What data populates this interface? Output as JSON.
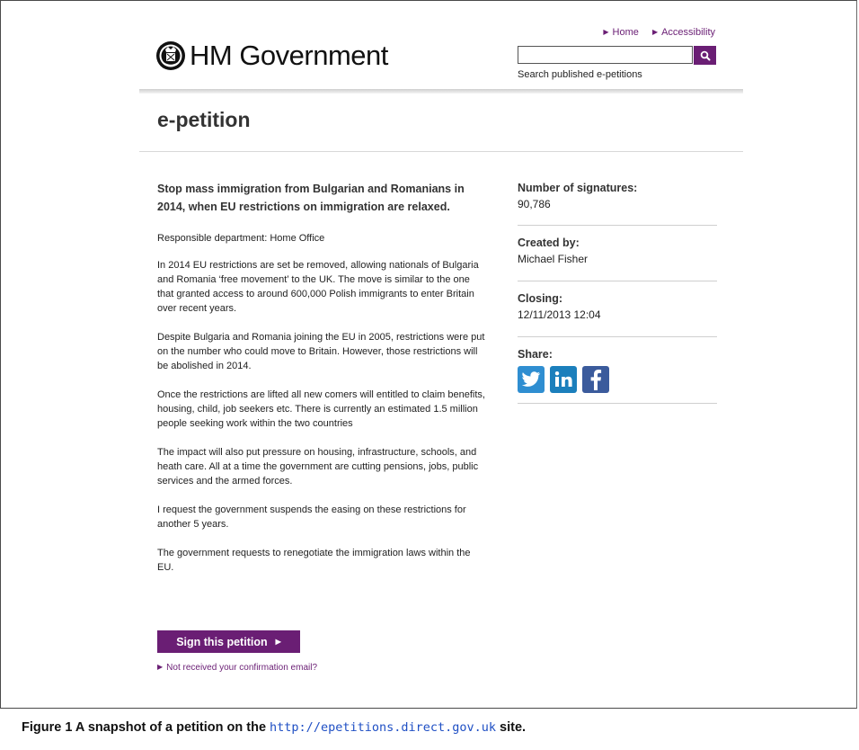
{
  "header": {
    "logo_text": "HM Government",
    "nav": [
      {
        "label": "Home"
      },
      {
        "label": "Accessibility"
      }
    ],
    "search": {
      "value": "",
      "caption": "Search published e-petitions"
    }
  },
  "page_title": "e-petition",
  "petition": {
    "heading": "Stop mass immigration from Bulgarian and Romanians in 2014, when EU restrictions on immigration are relaxed.",
    "department": "Responsible department: Home Office",
    "paragraphs": [
      "In 2014 EU restrictions are set be removed, allowing nationals of Bulgaria and Romania ‘free movement’ to the UK. The move is similar to the one that granted access to around 600,000 Polish immigrants to enter Britain over recent years.",
      "Despite Bulgaria and Romania joining the EU in 2005, restrictions were put on the number who could move to Britain. However, those restrictions will be abolished in 2014.",
      "Once the restrictions are lifted all new comers will entitled to claim benefits, housing, child, job seekers etc. There is currently an estimated 1.5 million people seeking work within the two countries",
      "The impact will also put pressure on housing, infrastructure, schools, and heath care. All at a time the government are cutting pensions, jobs, public services and the armed forces.",
      "I request the government suspends the easing on these restrictions for another 5 years.",
      "The government requests to renegotiate the immigration laws within the EU."
    ],
    "sign_button": "Sign this petition",
    "confirmation_link": "Not received your confirmation email?"
  },
  "sidebar": {
    "signatures_label": "Number of signatures:",
    "signatures_value": "90,786",
    "created_label": "Created by:",
    "created_value": "Michael Fisher",
    "closing_label": "Closing:",
    "closing_value": "12/11/2013 12:04",
    "share_label": "Share:",
    "share_icons": [
      "twitter-icon",
      "linkedin-icon",
      "facebook-icon"
    ]
  },
  "caption": {
    "prefix": "Figure 1  A snapshot of a petition on the",
    "url": "http://epetitions.direct.gov.uk",
    "suffix": "site."
  },
  "colors": {
    "accent": "#6a1e74",
    "twitter": "#2f8ed1",
    "linkedin": "#1b7fbc",
    "facebook": "#3b5b9c",
    "caption_link": "#1f4fc4"
  }
}
